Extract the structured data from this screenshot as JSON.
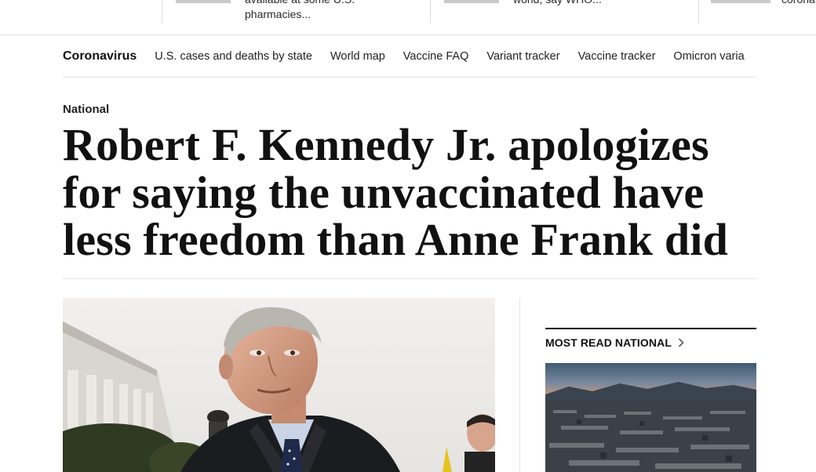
{
  "top_teasers": [
    {
      "line1": "available at some U.S.",
      "line2": "pharmacies..."
    },
    {
      "line1": "world, say WHO...",
      "line2": ""
    },
    {
      "line1": "corona",
      "line2": ""
    }
  ],
  "section_nav": {
    "brand": "Coronavirus",
    "links": [
      "U.S. cases and deaths by state",
      "World map",
      "Vaccine FAQ",
      "Variant tracker",
      "Vaccine tracker",
      "Omicron varia"
    ]
  },
  "article": {
    "kicker": "National",
    "headline": "Robert F. Kennedy Jr. apologizes for saying the unvaccinated have less freedom than Anne Frank did"
  },
  "most_read": {
    "title": "MOST READ NATIONAL",
    "icon": "chevron-right-icon"
  }
}
